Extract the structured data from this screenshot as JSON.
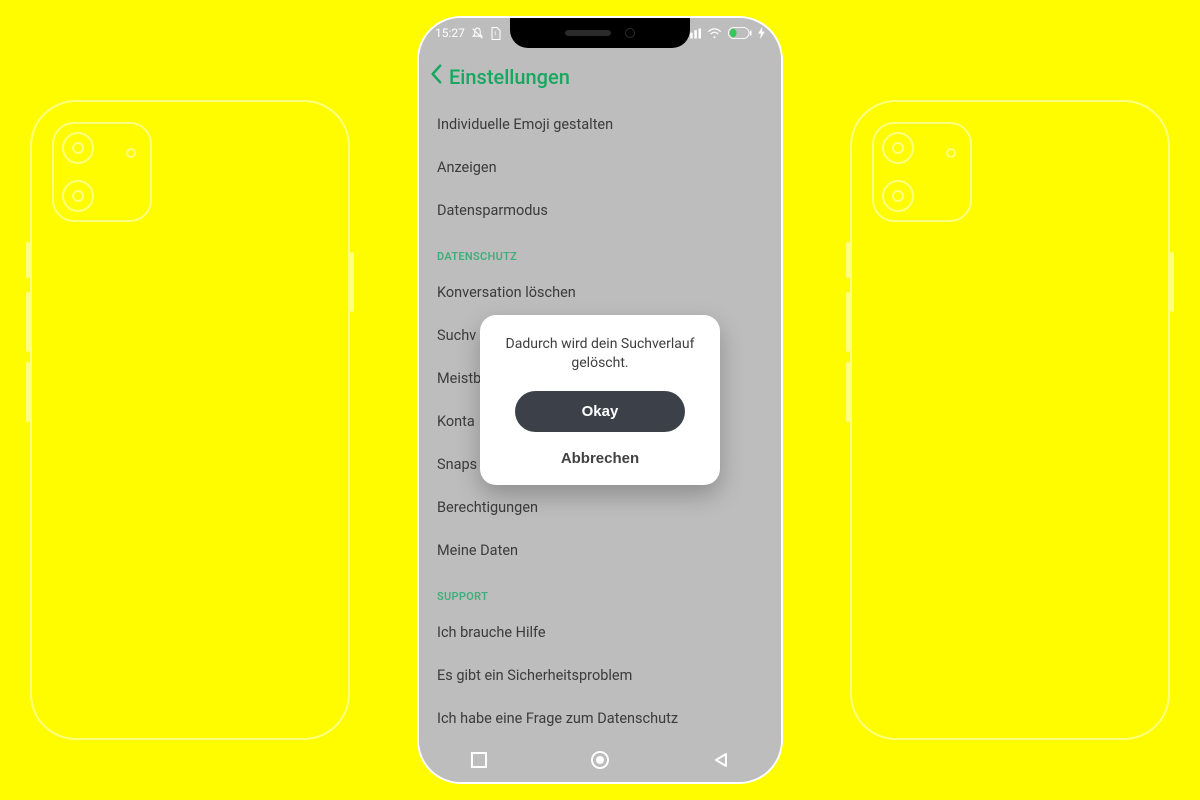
{
  "status_bar": {
    "time": "15:27"
  },
  "header": {
    "title": "Einstellungen"
  },
  "settings": {
    "items_top": [
      "Individuelle Emoji gestalten",
      "Anzeigen",
      "Datensparmodus"
    ],
    "section_privacy": "DATENSCHUTZ",
    "items_privacy": [
      "Konversation löschen",
      "Suchv",
      "Meistb",
      "Konta",
      "Snaps",
      "Berechtigungen",
      "Meine Daten"
    ],
    "section_support": "SUPPORT",
    "items_support": [
      "Ich brauche Hilfe",
      "Es gibt ein Sicherheitsproblem",
      "Ich habe eine Frage zum Datenschutz"
    ]
  },
  "dialog": {
    "message": "Dadurch wird dein Suchverlauf gelöscht.",
    "confirm_label": "Okay",
    "cancel_label": "Abbrechen"
  }
}
